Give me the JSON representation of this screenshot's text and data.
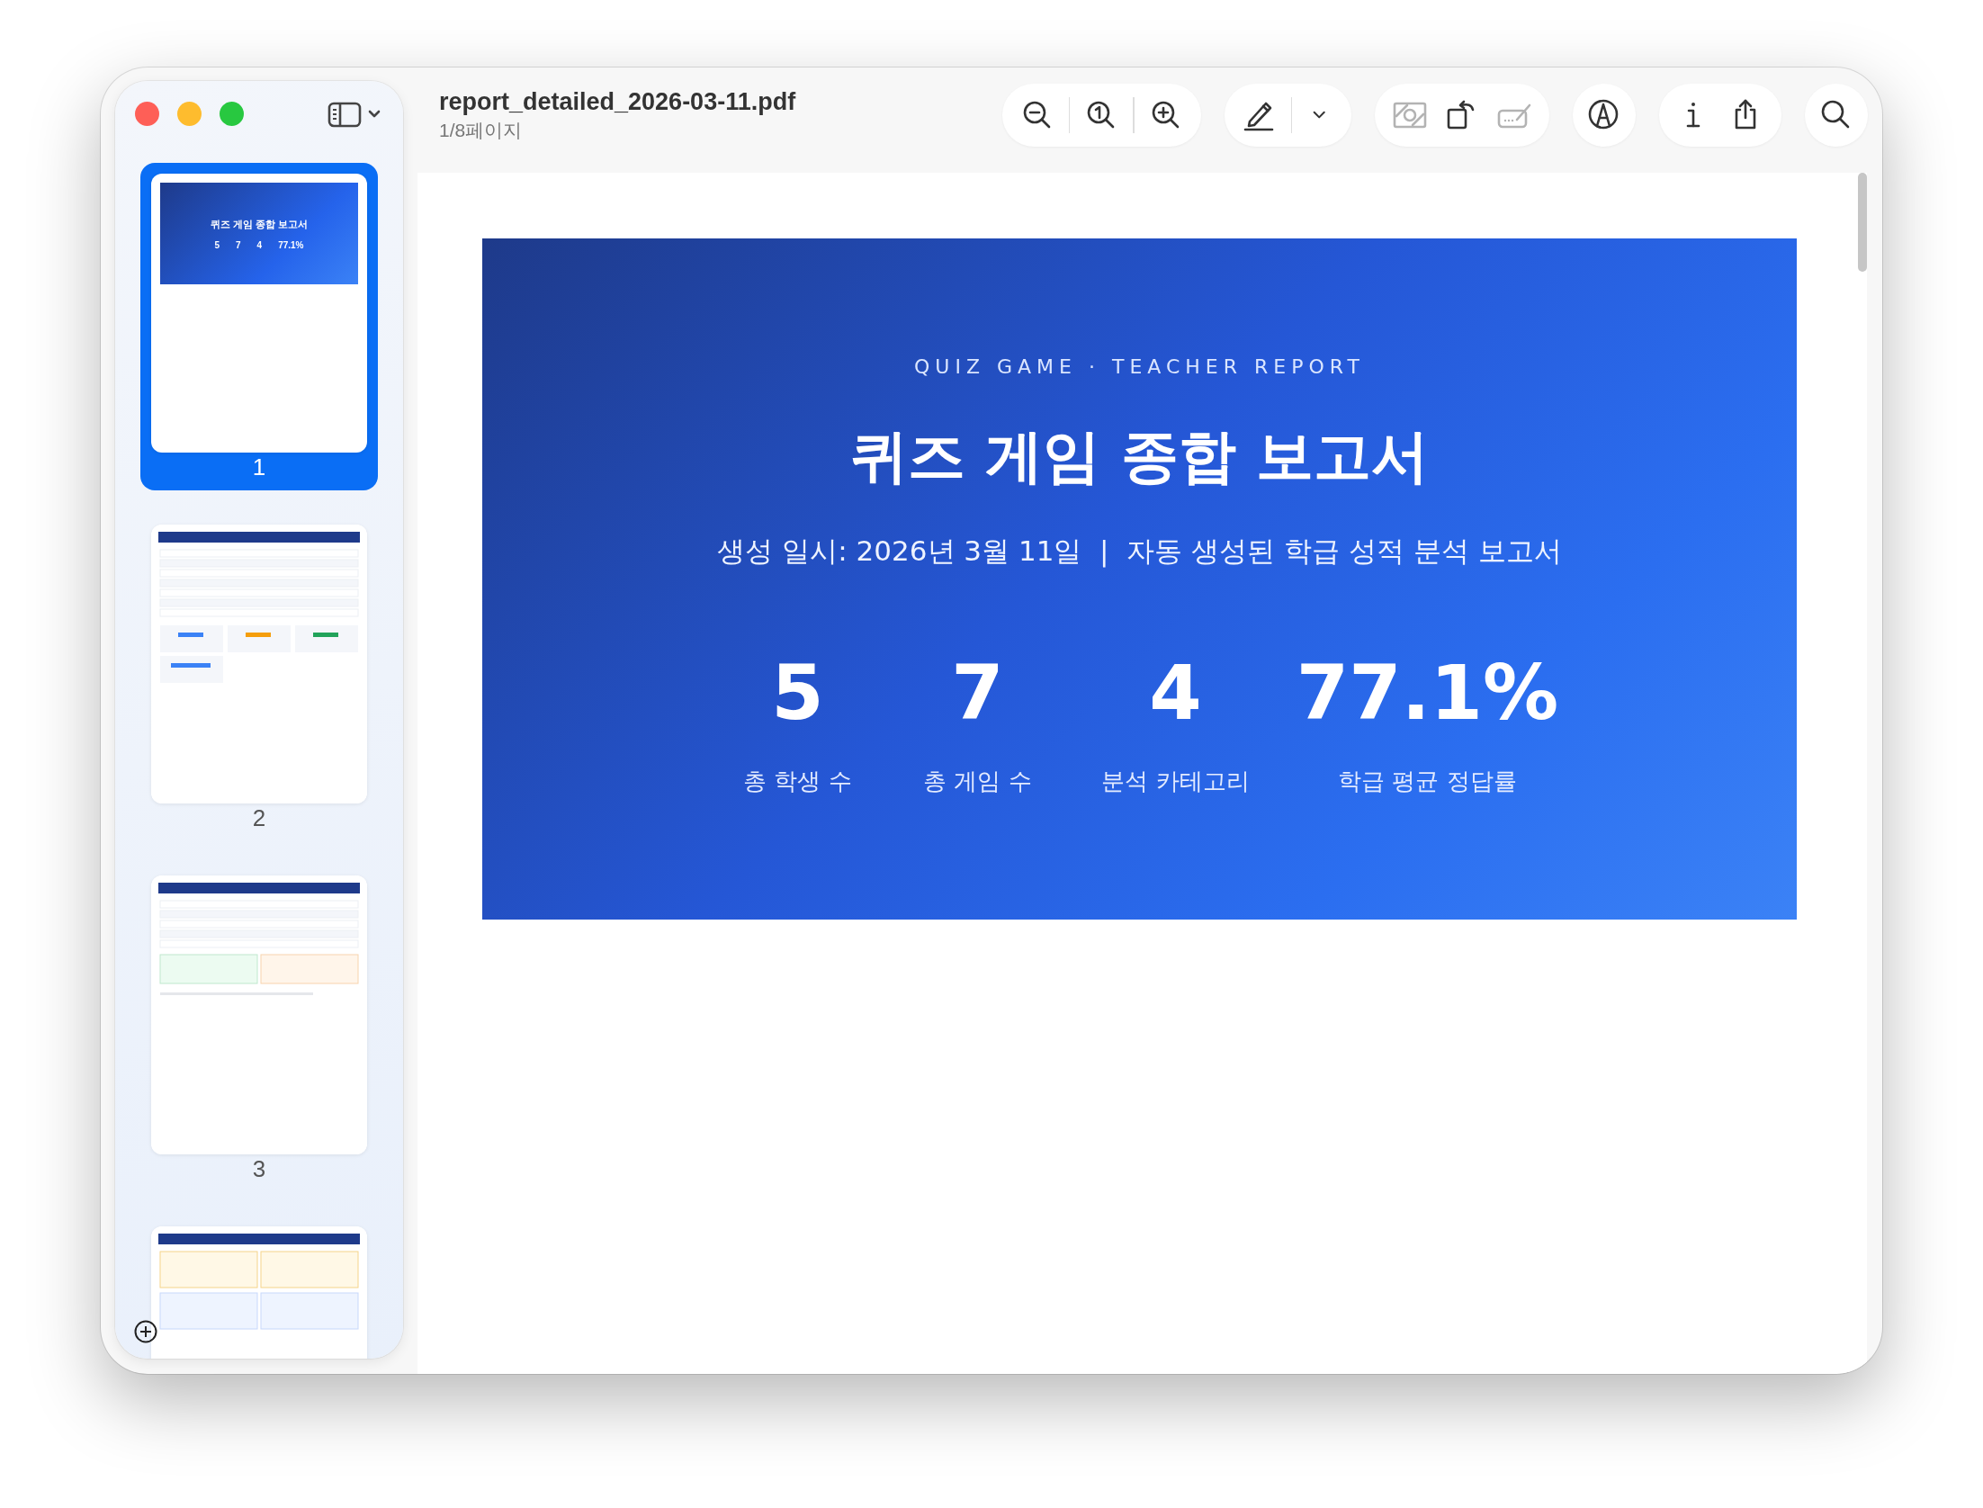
{
  "window": {
    "title": "report_detailed_2026-03-11.pdf",
    "subtitle": "1/8페이지"
  },
  "toolbar": [
    {
      "dividers": true,
      "items": [
        {
          "kind": "zoom-out",
          "disabled": false
        },
        {
          "kind": "actual-size",
          "disabled": false
        },
        {
          "kind": "zoom-in",
          "disabled": false
        }
      ]
    },
    {
      "dividers": true,
      "items": [
        {
          "kind": "highlight",
          "disabled": false
        },
        {
          "kind": "chevron",
          "disabled": false
        }
      ]
    },
    {
      "dividers": false,
      "items": [
        {
          "kind": "crop",
          "disabled": true
        },
        {
          "kind": "rotate",
          "disabled": false
        },
        {
          "kind": "signature",
          "disabled": true
        }
      ]
    },
    {
      "items": [
        {
          "kind": "markup",
          "disabled": false
        }
      ]
    },
    {
      "dividers": false,
      "items": [
        {
          "kind": "info",
          "disabled": false
        },
        {
          "kind": "share",
          "disabled": false
        }
      ]
    },
    {
      "items": [
        {
          "kind": "search",
          "disabled": false
        }
      ]
    }
  ],
  "sidebar": {
    "thumbnails": [
      {
        "label": "1",
        "selected": true,
        "preview": {
          "title": "퀴즈 게임 종합 보고서",
          "stats": [
            "5",
            "7",
            "4",
            "77.1%"
          ]
        }
      },
      {
        "label": "2",
        "selected": false
      },
      {
        "label": "3",
        "selected": false
      },
      {
        "selected": false
      }
    ]
  },
  "report": {
    "eyebrow": "QUIZ GAME · TEACHER REPORT",
    "title": "퀴즈 게임 종합 보고서",
    "subtitle": "생성 일시: 2026년 3월 11일  |  자동 생성된 학급 성적 분석 보고서",
    "stats": [
      {
        "value": "5",
        "label": "총 학생 수"
      },
      {
        "value": "7",
        "label": "총 게임 수"
      },
      {
        "value": "4",
        "label": "분석 카테고리"
      },
      {
        "value": "77.1%",
        "label": "학급 평균 정답률"
      }
    ]
  }
}
